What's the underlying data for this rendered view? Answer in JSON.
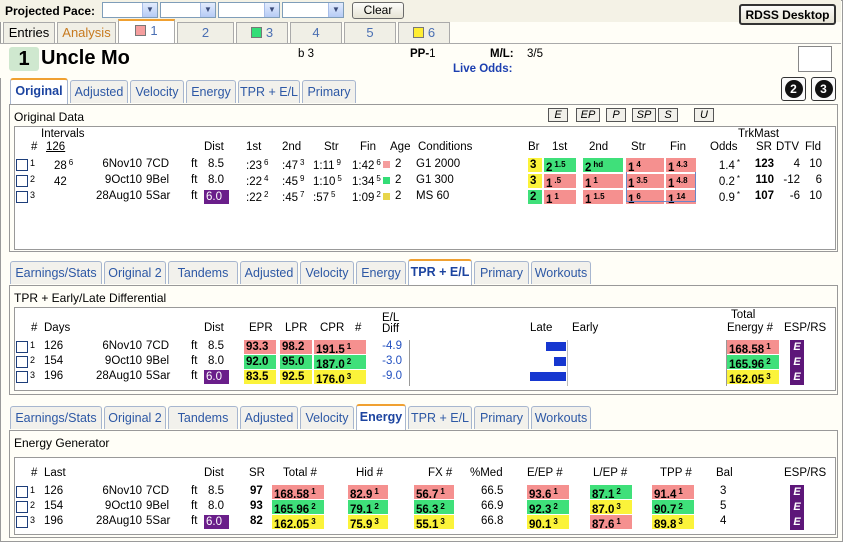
{
  "topbar": {
    "label": "Projected Pace:",
    "clear": "Clear",
    "rdss": "RDSS Desktop"
  },
  "toptabs": [
    {
      "label": "Entries"
    },
    {
      "label": "Analysis"
    },
    {
      "label": "1",
      "color": "#f59e9e"
    },
    {
      "label": "2",
      "color": ""
    },
    {
      "label": "3",
      "color": "#33dd77"
    },
    {
      "label": "4",
      "color": ""
    },
    {
      "label": "5",
      "color": ""
    },
    {
      "label": "6",
      "color": "#ffee33"
    }
  ],
  "horse": {
    "num": "1",
    "name": "Uncle Mo",
    "sex": "b 3",
    "pp_label": "PP-",
    "pp": "1",
    "ml_label": "M/L:",
    "ml": "3/5",
    "live": "Live Odds:"
  },
  "tabs_a": [
    "Original",
    "Adjusted",
    "Velocity",
    "Energy",
    "TPR + E/L",
    "Primary"
  ],
  "orig": {
    "title": "Original Data",
    "buttons": [
      "E",
      "EP",
      "P",
      "SP",
      "S",
      "U"
    ],
    "headers": {
      "num": "#",
      "intervals": "Intervals",
      "iv": "126",
      "dist": "Dist",
      "first": "1st",
      "second": "2nd",
      "str": "Str",
      "fin": "Fin",
      "age": "Age",
      "cond": "Conditions",
      "br": "Br",
      "b1": "1st",
      "b2": "2nd",
      "bstr": "Str",
      "bfin": "Fin",
      "odds": "Odds",
      "trk": "TrkMast",
      "sr": "SR",
      "dtv": "DTV",
      "fld": "Fld"
    },
    "rows": [
      {
        "n": "1",
        "iv1": "28",
        "iv1s": "6",
        "date": "6Nov10",
        "track": "7CD",
        "ft": "ft",
        "dist": "8.5",
        "f1": ":23",
        "f1s": "6",
        "f2": ":47",
        "f2s": "3",
        "fs": "1:11",
        "fss": "9",
        "ff": "1:42",
        "ffs": "6",
        "age": "2",
        "cond": "G1 2000",
        "br": "3",
        "c1": "2",
        "c1s": "1.5",
        "c2": "2",
        "c2s": "hd",
        "cs": "1",
        "css": "4",
        "cf": "1",
        "cfs": "4.3",
        "odds": "1.4",
        "sr": "123",
        "dtv": "4",
        "fld": "10",
        "sqc": "#f59e9e"
      },
      {
        "n": "2",
        "iv1": "42",
        "iv1s": "",
        "date": "9Oct10",
        "track": "9Bel",
        "ft": "ft",
        "dist": "8.0",
        "f1": ":22",
        "f1s": "4",
        "f2": ":45",
        "f2s": "9",
        "fs": "1:10",
        "fss": "5",
        "ff": "1:34",
        "ffs": "5",
        "age": "2",
        "cond": "G1 300",
        "br": "3",
        "c1": "1",
        "c1s": ".5",
        "c2": "1",
        "c2s": "1",
        "cs": "1",
        "css": "3.5",
        "cf": "1",
        "cfs": "4.8",
        "odds": "0.2",
        "sr": "110",
        "dtv": "-12",
        "fld": "6",
        "sqc": "#33dd77"
      },
      {
        "n": "3",
        "iv1": "",
        "iv1s": "",
        "date": "28Aug10",
        "track": "5Sar",
        "ft": "ft",
        "dist": "6.0",
        "f1": ":22",
        "f1s": "2",
        "f2": ":45",
        "f2s": "7",
        "fs": ":57",
        "fss": "5",
        "ff": "1:09",
        "ffs": "2",
        "age": "2",
        "cond": "MS 60",
        "br": "2",
        "c1": "1",
        "c1s": "1",
        "c2": "1",
        "c2s": "1.5",
        "cs": "1",
        "css": "6",
        "cf": "1",
        "cfs": "14",
        "odds": "0.9",
        "sr": "107",
        "dtv": "-6",
        "fld": "10",
        "sqc": "#e8d54a"
      }
    ]
  },
  "tabs_b": [
    "Earnings/Stats",
    "Original 2",
    "Tandems",
    "Adjusted",
    "Velocity",
    "Energy",
    "TPR + E/L",
    "Primary",
    "Workouts"
  ],
  "tpr": {
    "title": "TPR + Early/Late Differential",
    "headers": {
      "num": "#",
      "days": "Days",
      "dist": "Dist",
      "epr": "EPR",
      "lpr": "LPR",
      "cpr": "CPR",
      "hash": "#",
      "el": "E/L",
      "diff": "Diff",
      "late": "Late",
      "early": "Early",
      "total": "Total",
      "energy": "Energy #",
      "esp": "ESP/RS"
    },
    "rows": [
      {
        "n": "1",
        "days": "126",
        "date": "6Nov10",
        "track": "7CD",
        "ft": "ft",
        "dist": "8.5",
        "epr": "93.3",
        "lpr": "98.2",
        "cpr": "191.5",
        "cr": "1",
        "diff": "-4.9",
        "energy": "168.58",
        "er": "1",
        "esp": "E",
        "late": 4.9
      },
      {
        "n": "2",
        "days": "154",
        "date": "9Oct10",
        "track": "9Bel",
        "ft": "ft",
        "dist": "8.0",
        "epr": "92.0",
        "lpr": "95.0",
        "cpr": "187.0",
        "cr": "2",
        "diff": "-3.0",
        "energy": "165.96",
        "er": "2",
        "esp": "E",
        "late": 3.0
      },
      {
        "n": "3",
        "days": "196",
        "date": "28Aug10",
        "track": "5Sar",
        "ft": "ft",
        "dist": "6.0",
        "epr": "83.5",
        "lpr": "92.5",
        "cpr": "176.0",
        "cr": "3",
        "diff": "-9.0",
        "energy": "162.05",
        "er": "3",
        "esp": "E",
        "late": 9.0
      }
    ]
  },
  "tabs_c": [
    "Earnings/Stats",
    "Original 2",
    "Tandems",
    "Adjusted",
    "Velocity",
    "Energy",
    "TPR + E/L",
    "Primary",
    "Workouts"
  ],
  "energy": {
    "title": "Energy Generator",
    "headers": {
      "num": "#",
      "last": "Last",
      "dist": "Dist",
      "sr": "SR",
      "total": "Total #",
      "hid": "Hid #",
      "fx": "FX #",
      "med": "%Med",
      "eep": "E/EP #",
      "lep": "L/EP #",
      "tpp": "TPP #",
      "bal": "Bal",
      "esp": "ESP/RS"
    },
    "rows": [
      {
        "n": "1",
        "last": "126",
        "date": "6Nov10",
        "track": "7CD",
        "ft": "ft",
        "dist": "8.5",
        "sr": "97",
        "total": "168.58",
        "tr": "1",
        "hid": "82.9",
        "hr": "1",
        "fx": "56.7",
        "fr": "1",
        "med": "66.5",
        "eep": "93.6",
        "er": "1",
        "lep": "87.1",
        "lr": "2",
        "tpp": "91.4",
        "pr": "1",
        "bal": "3",
        "esp": "E"
      },
      {
        "n": "2",
        "last": "154",
        "date": "9Oct10",
        "track": "9Bel",
        "ft": "ft",
        "dist": "8.0",
        "sr": "93",
        "total": "165.96",
        "tr": "2",
        "hid": "79.1",
        "hr": "2",
        "fx": "56.3",
        "fr": "2",
        "med": "66.9",
        "eep": "92.3",
        "er": "2",
        "lep": "87.0",
        "lr": "3",
        "tpp": "90.7",
        "pr": "2",
        "bal": "5",
        "esp": "E"
      },
      {
        "n": "3",
        "last": "196",
        "date": "28Aug10",
        "track": "5Sar",
        "ft": "ft",
        "dist": "6.0",
        "sr": "82",
        "total": "162.05",
        "tr": "3",
        "hid": "75.9",
        "hr": "3",
        "fx": "55.1",
        "fr": "3",
        "med": "66.8",
        "eep": "90.1",
        "er": "3",
        "lep": "87.6",
        "lr": "1",
        "tpp": "89.8",
        "pr": "3",
        "bal": "4",
        "esp": "E"
      }
    ]
  },
  "rankcolors": {
    "1": "#f5908f",
    "2": "#3fe07a",
    "3": "#fbf33a"
  },
  "bar_color": "#1637d0"
}
